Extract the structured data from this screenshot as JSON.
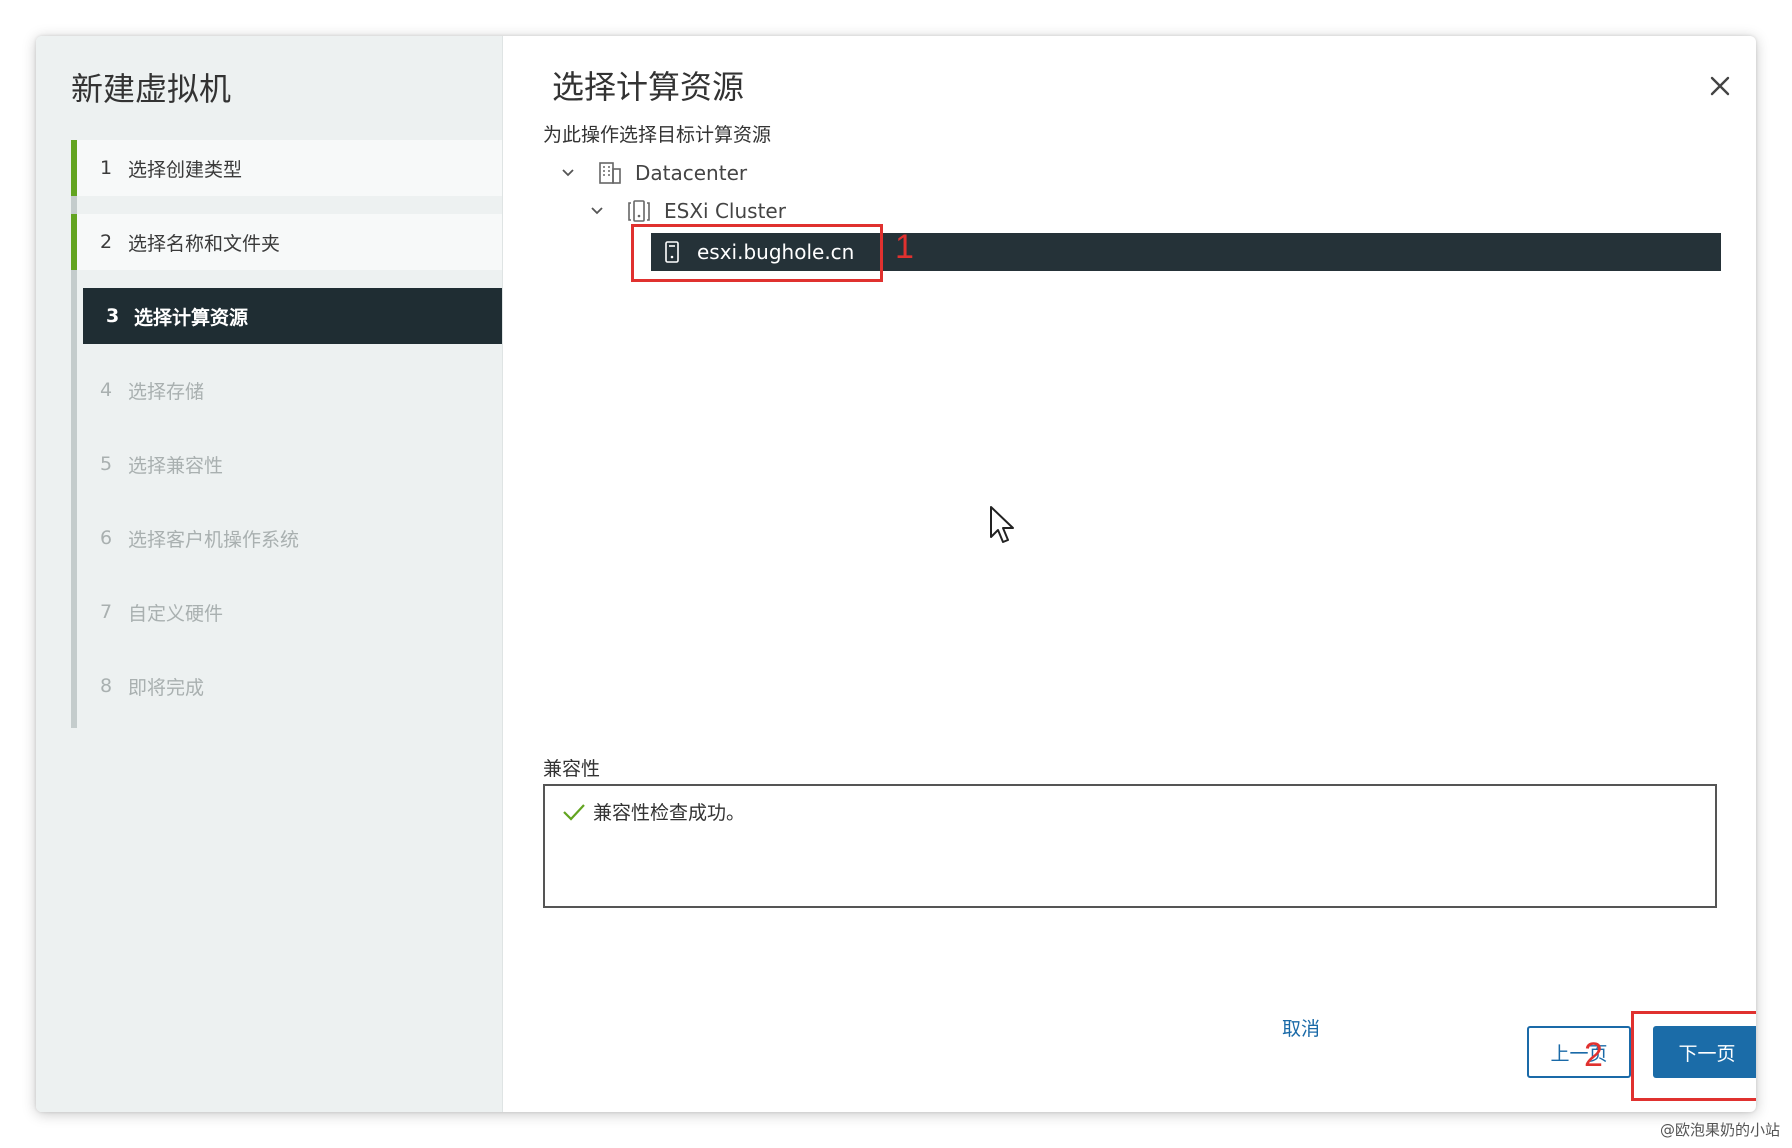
{
  "sidebar": {
    "title": "新建虚拟机",
    "steps": [
      {
        "num": "1",
        "label": "选择创建类型"
      },
      {
        "num": "2",
        "label": "选择名称和文件夹"
      },
      {
        "num": "3",
        "label": "选择计算资源"
      },
      {
        "num": "4",
        "label": "选择存储"
      },
      {
        "num": "5",
        "label": "选择兼容性"
      },
      {
        "num": "6",
        "label": "选择客户机操作系统"
      },
      {
        "num": "7",
        "label": "自定义硬件"
      },
      {
        "num": "8",
        "label": "即将完成"
      }
    ],
    "active_step": 3
  },
  "main": {
    "title": "选择计算资源",
    "subtitle": "为此操作选择目标计算资源",
    "tree": {
      "datacenter": "Datacenter",
      "cluster": "ESXi Cluster",
      "host": "esxi.bughole.cn"
    },
    "compat_label": "兼容性",
    "compat_message": "兼容性检查成功。"
  },
  "footer": {
    "cancel": "取消",
    "back": "上一页",
    "next": "下一页"
  },
  "annotations": {
    "one": "1",
    "two": "2"
  },
  "watermark": "@欧泡果奶的小站",
  "colors": {
    "accent": "#1b6ca8",
    "selected_row": "#253238",
    "highlight": "#e0312f",
    "success": "#62a420"
  }
}
